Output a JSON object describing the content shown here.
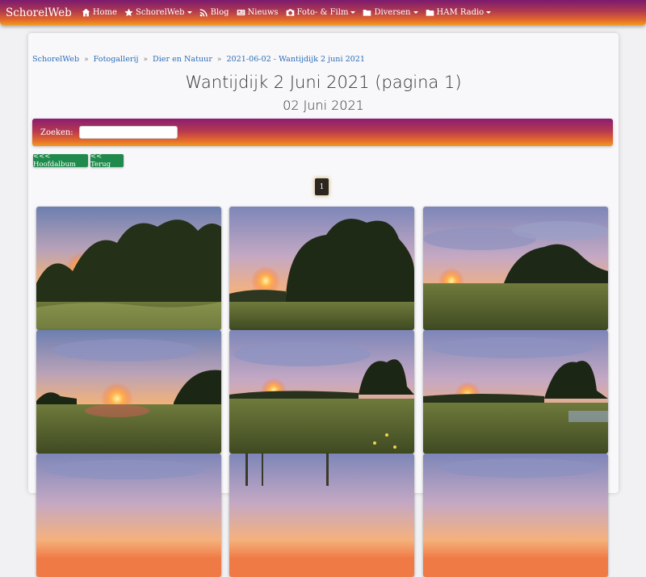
{
  "navbar": {
    "brand": "SchorelWeb",
    "items": [
      {
        "label": "Home",
        "icon": "home-icon",
        "dropdown": false
      },
      {
        "label": "SchorelWeb",
        "icon": "star-icon",
        "dropdown": true
      },
      {
        "label": "Blog",
        "icon": "rss-icon",
        "dropdown": false
      },
      {
        "label": "Nieuws",
        "icon": "newspaper-icon",
        "dropdown": false
      },
      {
        "label": "Foto- & Film",
        "icon": "camera-icon",
        "dropdown": true
      },
      {
        "label": "Diversen",
        "icon": "folder-icon",
        "dropdown": true
      },
      {
        "label": "HAM Radio",
        "icon": "folder-icon",
        "dropdown": true
      }
    ]
  },
  "breadcrumb": [
    "SchorelWeb",
    "Fotogallerij",
    "Dier en Natuur",
    "2021-06-02 - Wantijdijk 2 juni 2021"
  ],
  "breadcrumb_sep": "»",
  "page": {
    "title": "Wantijdijk 2 Juni 2021 (pagina 1)",
    "subtitle": "02 Juni 2021"
  },
  "search": {
    "label": "Zoeken:",
    "value": "",
    "placeholder": ""
  },
  "buttons": {
    "main_album": "<<< Hoofdalbum",
    "back": "<< Terug"
  },
  "pagination": {
    "current": "1"
  },
  "colors": {
    "nav_gradient_top": "#7b1a6f",
    "nav_gradient_bottom": "#f29a1c",
    "button_green": "#1f8a4c",
    "link_blue": "#2d6fb8"
  }
}
